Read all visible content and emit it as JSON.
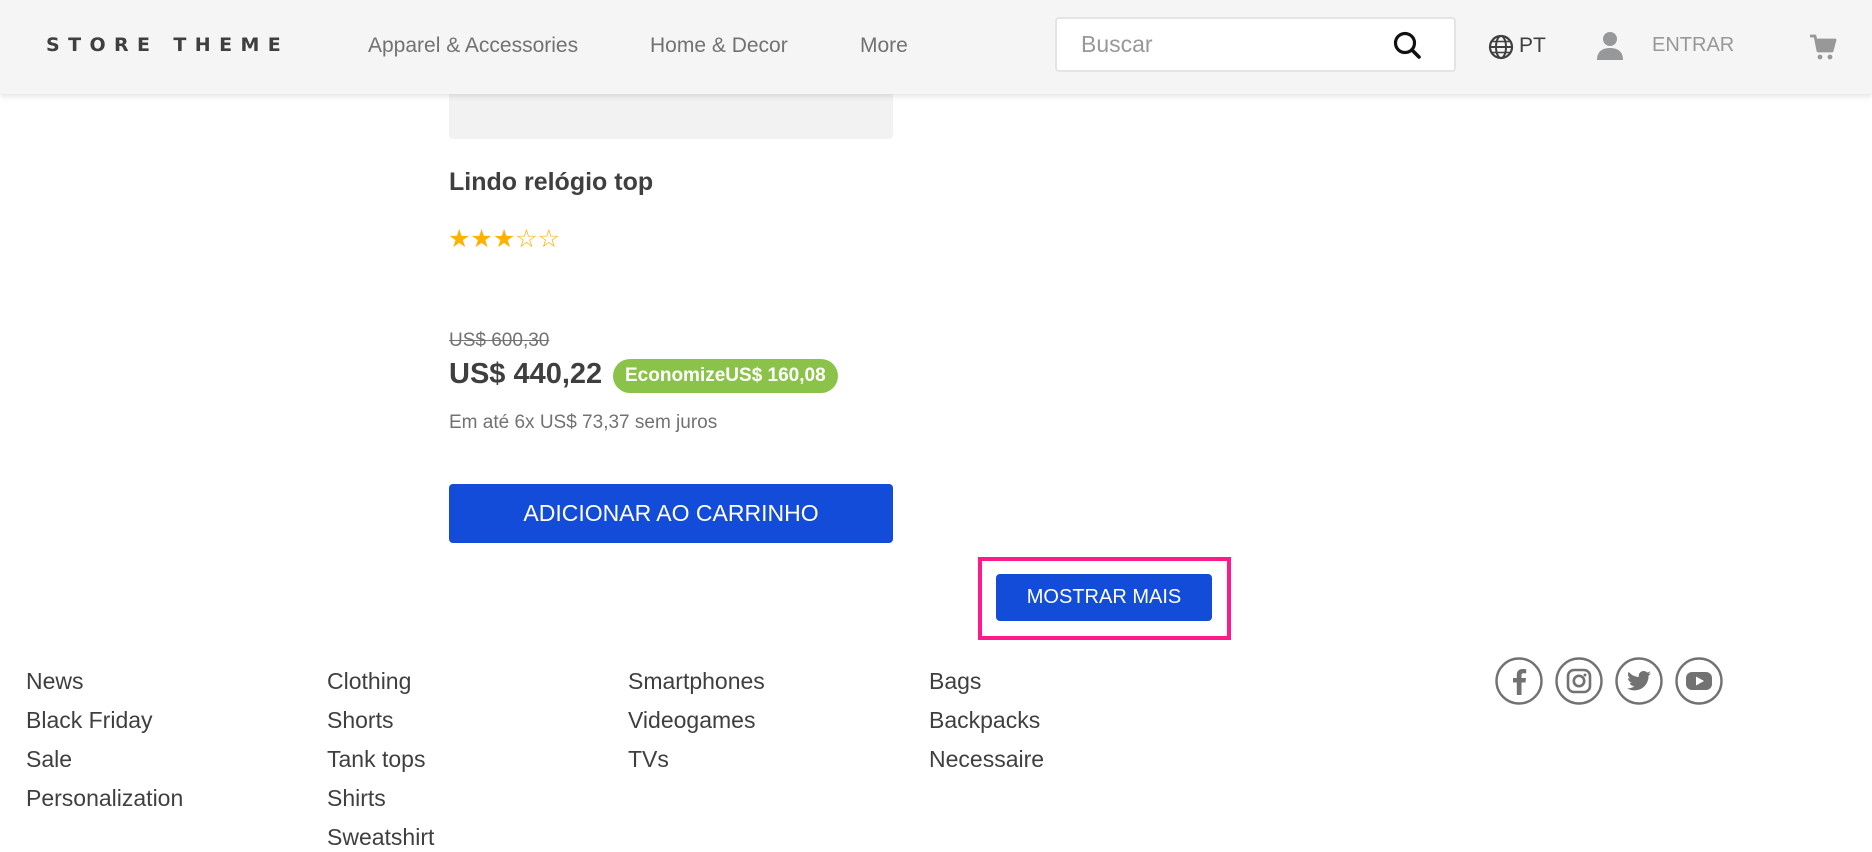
{
  "header": {
    "logo": "STORE THEME",
    "nav": [
      "Apparel & Accessories",
      "Home & Decor",
      "More"
    ],
    "search": {
      "placeholder": "Buscar",
      "value": ""
    },
    "locale": "PT",
    "login_label": "ENTRAR"
  },
  "product": {
    "name": "Lindo relógio top",
    "rating": 3,
    "rating_max": 5,
    "stars_text": "★★★☆☆",
    "list_price": "US$ 600,30",
    "selling_price": "US$ 440,22",
    "savings": "EconomizeUS$ 160,08",
    "installments": "Em até 6x US$ 73,37 sem juros",
    "add_to_cart_label": "ADICIONAR AO CARRINHO"
  },
  "show_more_label": "MOSTRAR MAIS",
  "footer": {
    "columns": [
      [
        "News",
        "Black Friday",
        "Sale",
        "Personalization"
      ],
      [
        "Clothing",
        "Shorts",
        "Tank tops",
        "Shirts",
        "Sweatshirt"
      ],
      [
        "Smartphones",
        "Videogames",
        "TVs"
      ],
      [
        "Bags",
        "Backpacks",
        "Necessaire"
      ]
    ],
    "social": [
      "facebook-icon",
      "instagram-icon",
      "twitter-icon",
      "youtube-icon"
    ]
  },
  "colors": {
    "primary": "#134cd8",
    "success": "#8bc34a",
    "star": "#ffb100",
    "highlight": "#ff1a8c"
  }
}
